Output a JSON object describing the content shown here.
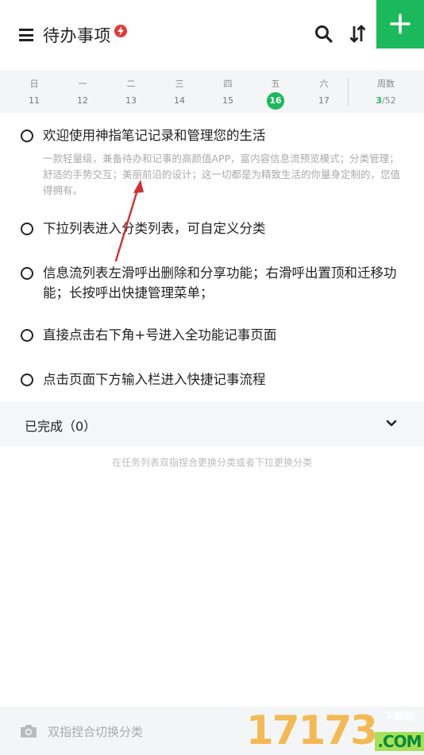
{
  "header": {
    "title": "待办事项",
    "menu_icon": "hamburger-menu-icon",
    "badge_icon": "lightning-badge-icon",
    "actions": [
      "search-icon",
      "sort-icon",
      "grid-view-icon"
    ]
  },
  "week": {
    "days": [
      {
        "weekday": "日",
        "date": "11"
      },
      {
        "weekday": "一",
        "date": "12"
      },
      {
        "weekday": "二",
        "date": "13"
      },
      {
        "weekday": "三",
        "date": "14"
      },
      {
        "weekday": "四",
        "date": "15"
      },
      {
        "weekday": "五",
        "date": "16"
      },
      {
        "weekday": "六",
        "date": "17"
      }
    ],
    "active_index": 5,
    "weeknum_label": "周数",
    "weeknum_current": "3",
    "weeknum_total": "/52"
  },
  "tasks": [
    {
      "title": "欢迎使用神指笔记记录和管理您的生活",
      "desc": "一款轻量级，兼备待办和记事的高颜值APP，富内容信息流预览模式；分类管理；舒适的手势交互；美丽前沿的设计；这一切都是为精致生活的你量身定制的，您值得拥有。"
    },
    {
      "title": "下拉列表进入分类列表，可自定义分类",
      "desc": ""
    },
    {
      "title": "信息流列表左滑呼出删除和分享功能；右滑呼出置顶和迁移功能；长按呼出快捷管理菜单；",
      "desc": ""
    },
    {
      "title": "直接点击右下角+号进入全功能记事页面",
      "desc": ""
    },
    {
      "title": "点击页面下方输入栏进入快捷记事流程",
      "desc": ""
    }
  ],
  "completed": {
    "label": "已完成（0）"
  },
  "hint": "在任务列表双指捏合更换分类或者下拉更换分类",
  "bottom": {
    "placeholder": "双指捏合切换分类",
    "camera_icon": "camera-icon",
    "add_icon": "plus-icon"
  },
  "watermark": {
    "digits": "17173",
    "top": "下载站",
    "bottom": ".COM"
  },
  "colors": {
    "accent": "#1bb95c",
    "badge": "#e53935",
    "annotation_arrow": "#d32f2f"
  }
}
